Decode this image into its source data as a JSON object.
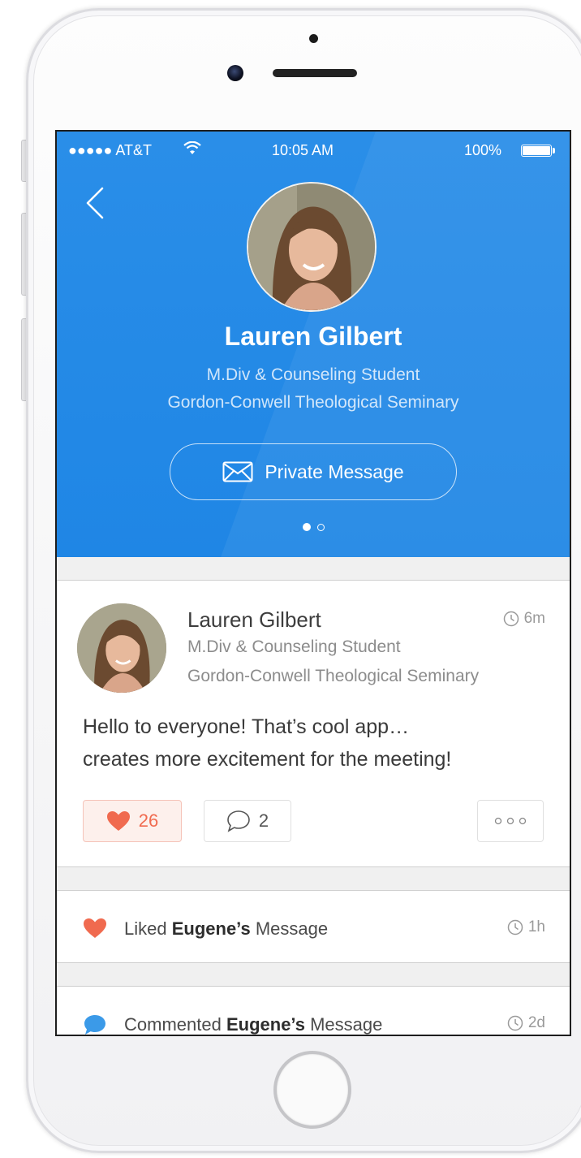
{
  "status_bar": {
    "carrier": "●●●●● AT&T",
    "time": "10:05 AM",
    "battery": "100%"
  },
  "profile": {
    "name": "Lauren Gilbert",
    "role": "M.Div & Counseling Student",
    "school": "Gordon-Conwell Theological Seminary",
    "message_button": "Private Message",
    "page_dots": {
      "total": 2,
      "active": 1
    }
  },
  "post": {
    "author": "Lauren Gilbert",
    "role": "M.Div & Counseling Student",
    "school": "Gordon-Conwell Theological Seminary",
    "time": "6m",
    "body_line1": "Hello to everyone! That’s cool app…",
    "body_line2": "creates more excitement for the meeting!",
    "likes": "26",
    "comments": "2"
  },
  "activities": [
    {
      "icon": "heart-icon",
      "verb": "Liked",
      "subject": "Eugene’s",
      "object": "Message",
      "time": "1h",
      "color": "#f06a4f"
    },
    {
      "icon": "comment-icon",
      "verb": "Commented",
      "subject": "Eugene’s",
      "object": "Message",
      "time": "2d",
      "color": "#3b9ae8"
    }
  ],
  "colors": {
    "accent": "#1f86e5",
    "like": "#f06a4f",
    "comment": "#3b9ae8"
  }
}
